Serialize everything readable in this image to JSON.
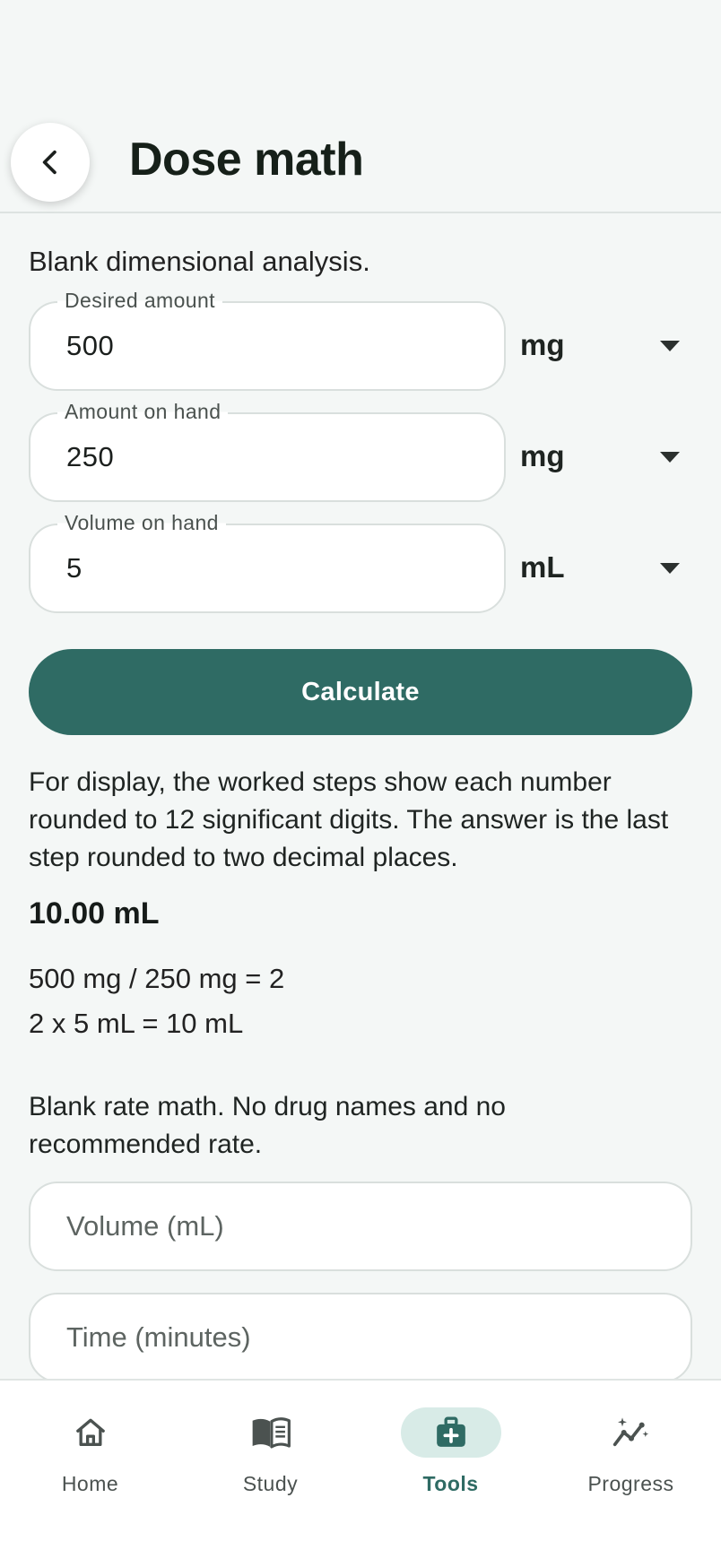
{
  "header": {
    "title": "Dose math"
  },
  "dose": {
    "intro": "Blank dimensional analysis.",
    "fields": [
      {
        "label": "Desired amount",
        "value": "500",
        "unit": "mg"
      },
      {
        "label": "Amount on hand",
        "value": "250",
        "unit": "mg"
      },
      {
        "label": "Volume on hand",
        "value": "5",
        "unit": "mL"
      }
    ],
    "calculate_label": "Calculate",
    "note": "For display, the worked steps show each number rounded to 12 significant digits. The answer is the last step rounded to two decimal places.",
    "answer": "10.00 mL",
    "steps": [
      "500 mg / 250 mg = 2",
      "2 x 5 mL = 10 mL"
    ]
  },
  "rate": {
    "intro": "Blank rate math. No drug names and no recommended rate.",
    "volume_placeholder": "Volume (mL)",
    "time_placeholder": "Time (minutes)"
  },
  "nav": {
    "items": [
      {
        "label": "Home",
        "icon": "home-icon"
      },
      {
        "label": "Study",
        "icon": "book-icon"
      },
      {
        "label": "Tools",
        "icon": "medical-kit-icon",
        "active": true
      },
      {
        "label": "Progress",
        "icon": "progress-chart-icon"
      }
    ]
  },
  "colors": {
    "accent": "#2f6b64",
    "accent_light": "#d8ebe7",
    "background": "#f4f7f6"
  }
}
